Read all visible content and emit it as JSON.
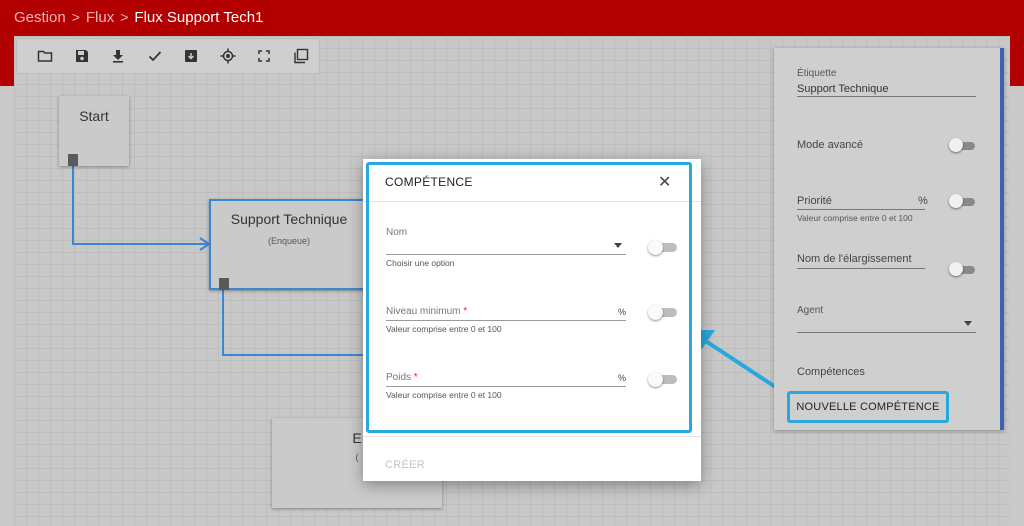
{
  "breadcrumb": {
    "items": [
      "Gestion",
      "Flux"
    ],
    "current": "Flux Support Tech1",
    "separator": ">"
  },
  "toolbar": {
    "icons": [
      "folder-icon",
      "save-icon",
      "download-icon",
      "check-icon",
      "archive-icon",
      "target-icon",
      "fullscreen-icon",
      "copy-icon"
    ]
  },
  "canvas": {
    "nodes": {
      "start": {
        "title": "Start"
      },
      "support": {
        "title": "Support Technique",
        "subtitle": "(Enqueue)"
      },
      "end": {
        "title": "E",
        "subtitle": "("
      }
    }
  },
  "panel": {
    "etiquette_label": "Étiquette",
    "etiquette_value": "Support Technique",
    "mode_avance": "Mode avancé",
    "priorite_label": "Priorité",
    "priorite_unit": "%",
    "priorite_hint": "Valeur comprise entre 0 et 100",
    "elargissement_label": "Nom de l'élargissement",
    "agent_label": "Agent",
    "competences_label": "Compétences",
    "new_competence_button": "NOUVELLE COMPÉTENCE"
  },
  "dialog": {
    "title": "COMPÉTENCE",
    "close": "✕",
    "nom_label": "Nom",
    "nom_hint": "Choisir une option",
    "niveau_label": "Niveau minimum",
    "niveau_unit": "%",
    "niveau_hint": "Valeur comprise entre 0 et 100",
    "poids_label": "Poids",
    "poids_unit": "%",
    "poids_hint": "Valeur comprise entre 0 et 100",
    "required_mark": "*",
    "create_button": "CRÉER"
  },
  "colors": {
    "brand_red": "#b20000",
    "highlight_blue": "#29a8e0",
    "flow_blue": "#3a86d6",
    "panel_accent": "#3a63b8"
  }
}
